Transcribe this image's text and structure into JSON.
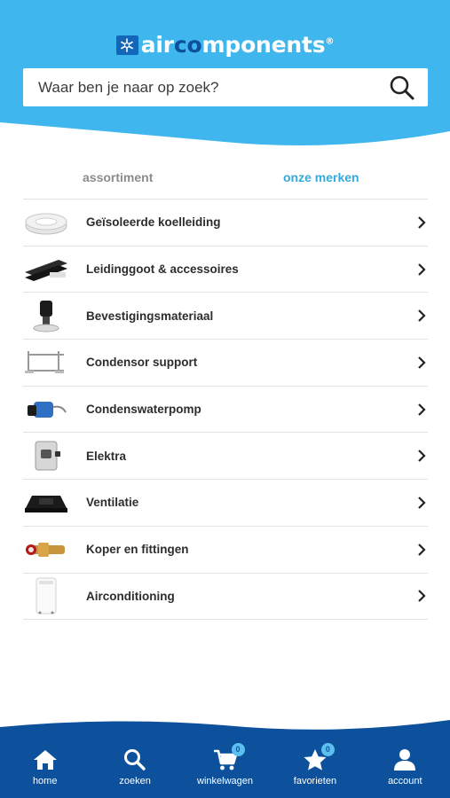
{
  "colors": {
    "header_blue": "#3fb6ee",
    "nav_blue": "#0d519d",
    "tab_active": "#33aadf",
    "tab_inactive": "#8b8b8b",
    "logo_dark": "#0c4f9c"
  },
  "logo": {
    "part1": "air",
    "part2": "co",
    "part3": "mponents",
    "mark": "®"
  },
  "search": {
    "placeholder": "Waar ben je naar op zoek?",
    "value": ""
  },
  "tabs": [
    {
      "label": "assortiment",
      "active": false
    },
    {
      "label": "onze merken",
      "active": true
    }
  ],
  "categories": [
    {
      "label": "Geïsoleerde koelleiding",
      "icon": "insulated-pipe-icon"
    },
    {
      "label": "Leidinggoot & accessoires",
      "icon": "pipe-duct-icon"
    },
    {
      "label": "Bevestigingsmateriaal",
      "icon": "mounting-icon"
    },
    {
      "label": "Condensor support",
      "icon": "bracket-icon"
    },
    {
      "label": "Condenswaterpomp",
      "icon": "pump-icon"
    },
    {
      "label": "Elektra",
      "icon": "switch-icon"
    },
    {
      "label": "Ventilatie",
      "icon": "vent-icon"
    },
    {
      "label": "Koper en fittingen",
      "icon": "fitting-icon"
    },
    {
      "label": "Airconditioning",
      "icon": "aircon-icon"
    }
  ],
  "nav": [
    {
      "label": "home",
      "icon": "home-icon"
    },
    {
      "label": "zoeken",
      "icon": "search-icon"
    },
    {
      "label": "winkelwagen",
      "icon": "cart-icon",
      "badge": "0"
    },
    {
      "label": "favorieten",
      "icon": "star-icon",
      "badge": "0"
    },
    {
      "label": "account",
      "icon": "user-icon"
    }
  ]
}
